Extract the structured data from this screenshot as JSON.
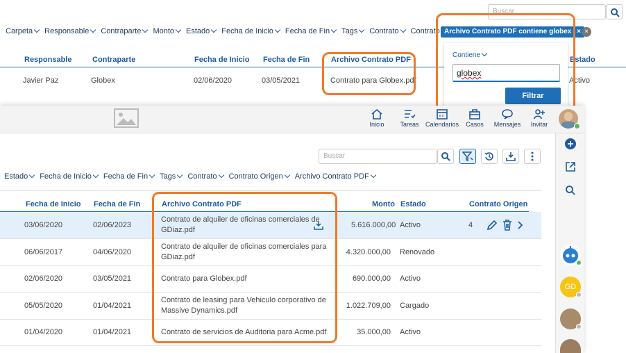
{
  "back": {
    "search_placeholder": "Buscar",
    "filters": [
      "Carpeta",
      "Responsable",
      "Contraparte",
      "Monto",
      "Estado",
      "Fecha de Inicio",
      "Fecha de Fin",
      "Tags",
      "Contrato",
      "Contrato Origen"
    ],
    "chip_label": "Archivo Contrato PDF contiene globex",
    "chip_close": "×",
    "headers": [
      "Responsable",
      "Contraparte",
      "Fecha de Inicio",
      "Fecha de Fin",
      "Archivo Contrato PDF",
      "Estado"
    ],
    "row": [
      "Javier Paz",
      "Globex",
      "02/06/2020",
      "03/05/2021",
      "Contrato para Globex.pdf",
      "Activo"
    ],
    "panel": {
      "operator": "Contiene",
      "value": "globex",
      "button": "Filtrar"
    }
  },
  "front": {
    "nav": [
      {
        "label": "Inicio",
        "icon": "home-icon"
      },
      {
        "label": "Tareas",
        "icon": "tasks-icon"
      },
      {
        "label": "Calendarios",
        "icon": "calendar-icon"
      },
      {
        "label": "Casos",
        "icon": "briefcase-icon"
      },
      {
        "label": "Mensajes",
        "icon": "chat-icon"
      },
      {
        "label": "Invitar",
        "icon": "add-user-icon"
      }
    ],
    "search_placeholder": "Buscar",
    "filters": [
      "Estado",
      "Fecha de Inicio",
      "Fecha de Fin",
      "Tags",
      "Contrato",
      "Contrato Origen",
      "Archivo Contrato PDF"
    ],
    "headers": {
      "start": "Fecha de Inicio",
      "end": "Fecha de Fin",
      "pdf": "Archivo Contrato PDF",
      "amount": "Monto",
      "status": "Estado",
      "origin": "Contrato Origen"
    },
    "rows": [
      {
        "start": "03/06/2020",
        "end": "02/06/2023",
        "pdf1": "Contrato de alquiler de oficinas comerciales de",
        "pdf2": "GDiaz.pdf",
        "amount": "5.616.000,00",
        "status": "Activo",
        "origin": "4"
      },
      {
        "start": "06/06/2017",
        "end": "04/06/2020",
        "pdf1": "Contrato de alquiler de oficinas comerciales para",
        "pdf2": "GDiaz.pdf",
        "amount": "4.320.000,00",
        "status": "Renovado",
        "origin": ""
      },
      {
        "start": "02/06/2020",
        "end": "03/05/2021",
        "pdf1": "Contrato para Globex.pdf",
        "pdf2": "",
        "amount": "690.000,00",
        "status": "Activo",
        "origin": ""
      },
      {
        "start": "05/05/2020",
        "end": "01/04/2021",
        "pdf1": "Contrato de leasing para Vehiculo corporativo de",
        "pdf2": "Massive Dynamics.pdf",
        "amount": "1.022.709,00",
        "status": "Cargado",
        "origin": ""
      },
      {
        "start": "01/04/2020",
        "end": "01/04/2021",
        "pdf1": "Contrato de servicios de Auditoria para Acme.pdf",
        "pdf2": "",
        "amount": "35.000,00",
        "status": "Activo",
        "origin": ""
      }
    ],
    "avatar_initials": "GD"
  },
  "colors": {
    "accent": "#1e6fb8",
    "highlight": "#f07a28",
    "selected_row": "#e3f0fb"
  }
}
